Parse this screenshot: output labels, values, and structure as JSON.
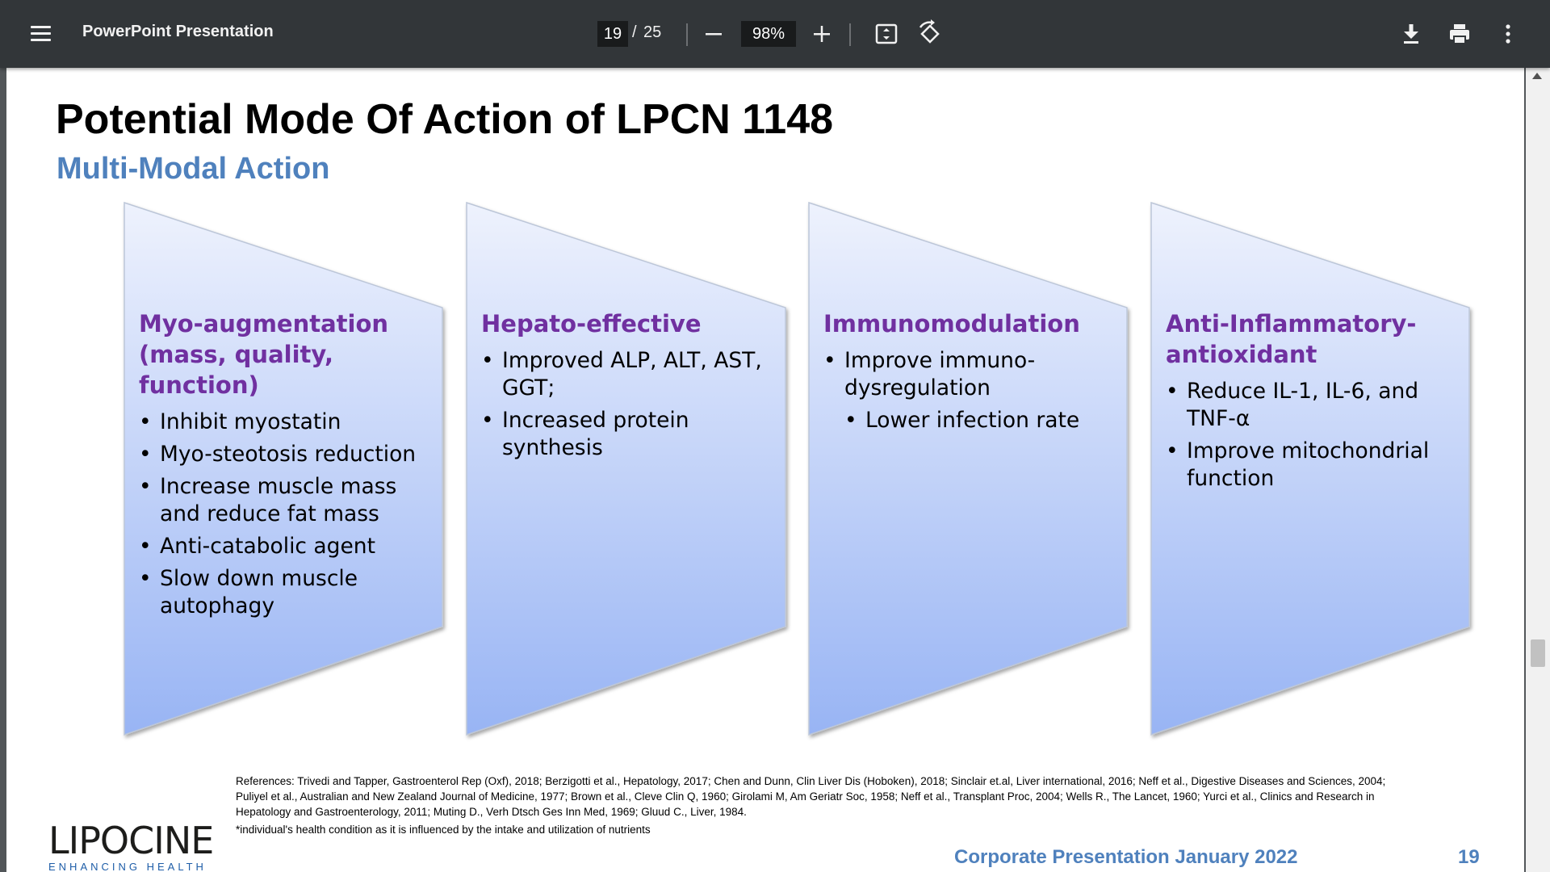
{
  "toolbar": {
    "title": "PowerPoint Presentation",
    "current_page": "19",
    "page_separator": "/",
    "total_pages": "25",
    "zoom": "98%",
    "icons": [
      "menu-icon",
      "minus-icon",
      "plus-icon",
      "fit-page-icon",
      "rotate-icon",
      "download-icon",
      "print-icon",
      "more-vert-icon"
    ]
  },
  "slide": {
    "title": "Potential Mode Of Action of LPCN 1148",
    "subtitle": "Multi-Modal Action",
    "panels": [
      {
        "heading": "Myo-augmentation (mass, quality, function)",
        "bullets": [
          "Inhibit myostatin",
          "Myo-steotosis reduction",
          "Increase muscle mass and reduce fat mass",
          "Anti-catabolic agent",
          "Slow down muscle autophagy"
        ]
      },
      {
        "heading": "Hepato-effective",
        "bullets": [
          "Improved ALP, ALT, AST, GGT;",
          " Increased protein synthesis"
        ]
      },
      {
        "heading": "Immunomodulation",
        "bullets": [
          "Improve immuno-dysregulation",
          "Lower infection rate"
        ]
      },
      {
        "heading": "Anti-Inflammatory-antioxidant",
        "bullets": [
          "Reduce IL-1, IL-6, and TNF-α",
          "Improve mitochondrial function"
        ]
      }
    ],
    "references": "References: Trivedi and Tapper, Gastroenterol Rep (Oxf), 2018; Berzigotti et al., Hepatology, 2017; Chen and Dunn, Clin Liver Dis (Hoboken), 2018; Sinclair et.al, Liver international, 2016; Neff et al., Digestive Diseases and Sciences, 2004; Puliyel et al., Australian and New Zealand Journal of Medicine, 1977; Brown et al., Cleve Clin Q, 1960; Girolami M, Am Geriatr Soc, 1958; Neff et al., Transplant Proc, 2004; Wells R., The Lancet, 1960; Yurci et al., Clinics and Research in Hepatology and Gastroenterology, 2011; Muting D., Verh Dtsch Ges Inn Med, 1969; Gluud C., Liver, 1984.",
    "footnote": "*individual's health condition as it is influenced by the intake and utilization of nutrients",
    "logo": {
      "name": "LIPOCINE",
      "tagline": "ENHANCING HEALTH"
    },
    "footer": "Corporate Presentation January 2022",
    "page_number": "19"
  },
  "colors": {
    "toolbar_bg": "#323639",
    "heading_purple": "#7030a0",
    "accent_blue": "#4f81bd",
    "panel_top": "#e8eefc",
    "panel_bottom": "#9db8f5"
  }
}
